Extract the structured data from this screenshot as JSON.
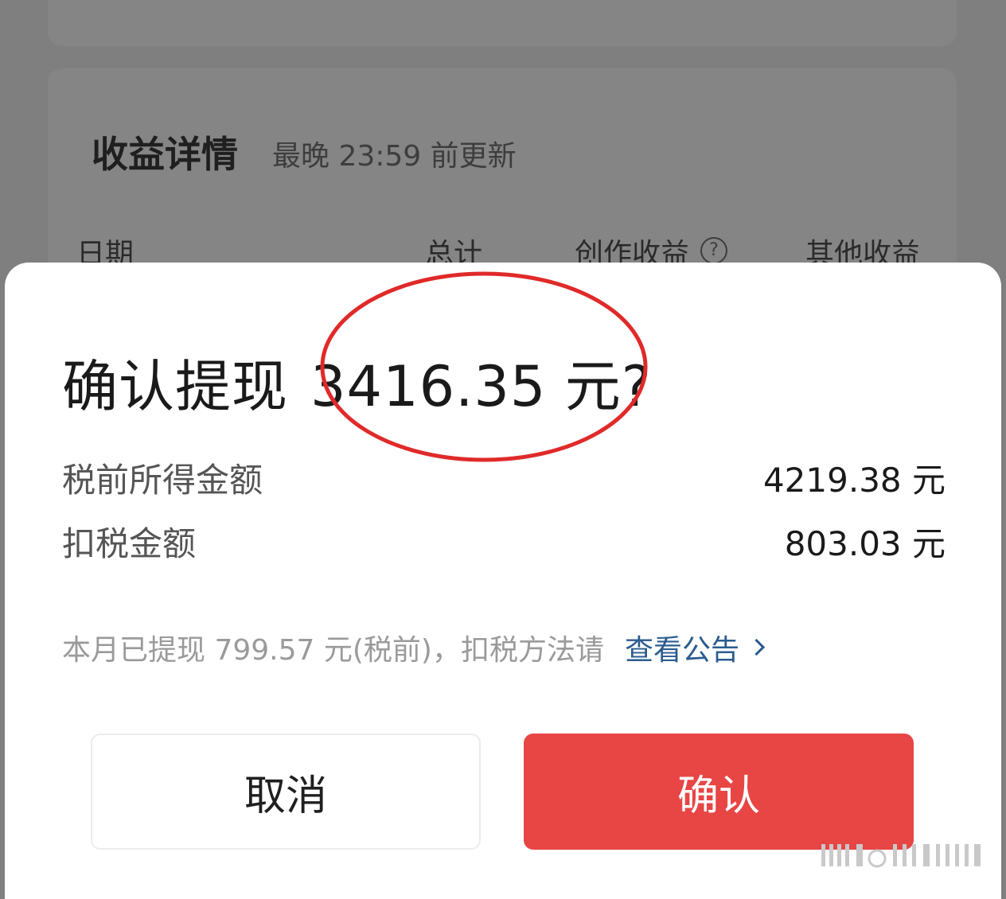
{
  "background": {
    "title": "收益详情",
    "subtitle": "最晚 23:59 前更新",
    "columns": [
      "日期",
      "总计",
      "创作收益",
      "其他收益"
    ],
    "help_icon": "question-circle-icon"
  },
  "dialog": {
    "title_prefix": "确认提现",
    "amount": "3416.35 元",
    "title_suffix": "?",
    "rows": [
      {
        "label": "税前所得金额",
        "value": "4219.38 元"
      },
      {
        "label": "扣税金额",
        "value": "803.03 元"
      }
    ],
    "note": "本月已提现 799.57 元(税前)，扣税方法请",
    "note_link": "查看公告",
    "cancel_label": "取消",
    "confirm_label": "确认"
  },
  "colors": {
    "accent": "#e84545",
    "link": "#2a5b8f",
    "annotation": "#e02a2a"
  }
}
